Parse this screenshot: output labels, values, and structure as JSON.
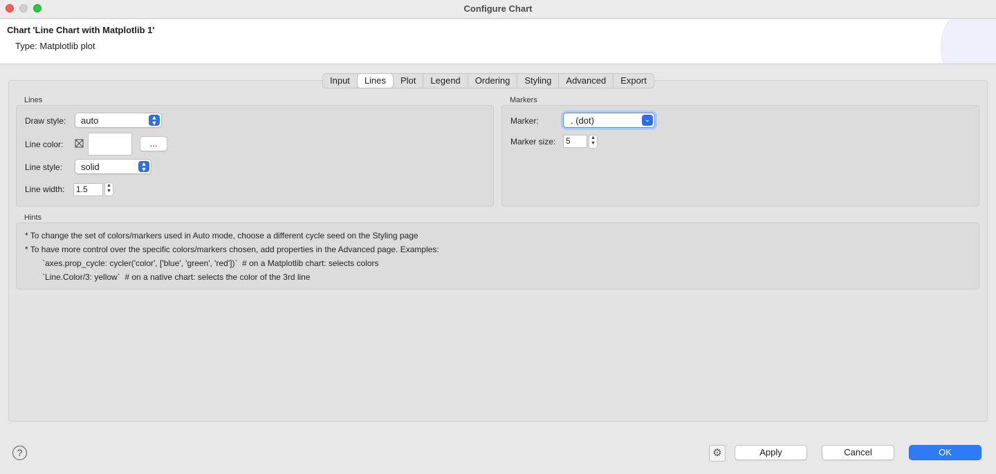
{
  "window": {
    "title": "Configure Chart"
  },
  "header": {
    "title": "Chart 'Line Chart with Matplotlib 1'",
    "subtitle": "Type: Matplotlib plot"
  },
  "tabs": [
    {
      "label": "Input"
    },
    {
      "label": "Lines",
      "active": true
    },
    {
      "label": "Plot"
    },
    {
      "label": "Legend"
    },
    {
      "label": "Ordering"
    },
    {
      "label": "Styling"
    },
    {
      "label": "Advanced"
    },
    {
      "label": "Export"
    }
  ],
  "lines_group": {
    "title": "Lines",
    "draw_style": {
      "label": "Draw style:",
      "value": "auto"
    },
    "line_color": {
      "label": "Line color:",
      "icon": "no-color-icon",
      "button": "..."
    },
    "line_style": {
      "label": "Line style:",
      "value": "solid"
    },
    "line_width": {
      "label": "Line width:",
      "value": "1.5"
    }
  },
  "markers_group": {
    "title": "Markers",
    "marker": {
      "label": "Marker:",
      "value": ". (dot)"
    },
    "marker_size": {
      "label": "Marker size:",
      "value": "5"
    }
  },
  "hints": {
    "title": "Hints",
    "lines": [
      "* To change the set of colors/markers used in Auto mode, choose a different cycle seed on the Styling page",
      "* To have more control over the specific colors/markers chosen, add properties in the Advanced page. Examples:",
      "`axes.prop_cycle: cycler('color', ['blue', 'green', 'red'])`  # on a Matplotlib chart: selects colors",
      "`Line.Color/3: yellow`  # on a native chart: selects the color of the 3rd line"
    ]
  },
  "footer": {
    "help": "?",
    "apply": "Apply",
    "cancel": "Cancel",
    "ok": "OK"
  },
  "colors": {
    "accent": "#2f7af5",
    "select_chevron": "#2f6fe6"
  }
}
